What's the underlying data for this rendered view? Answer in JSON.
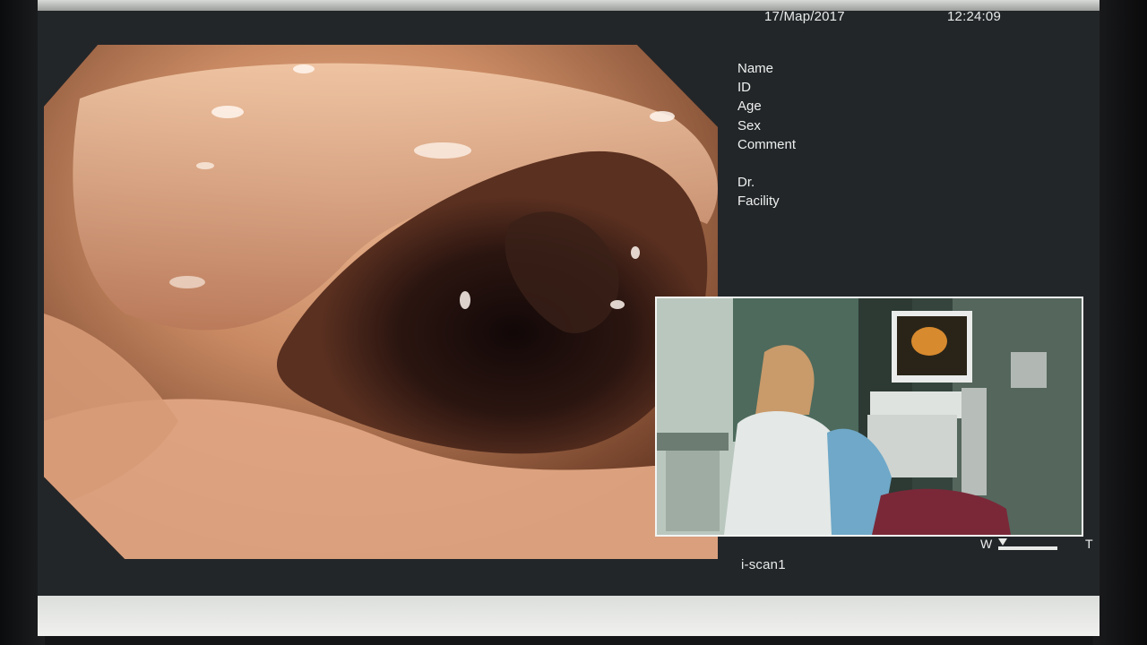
{
  "header": {
    "date": "17/Map/2017",
    "time": "12:24:09"
  },
  "patient_fields": {
    "name": "Name",
    "id": "ID",
    "age": "Age",
    "sex": "Sex",
    "comment": "Comment",
    "doctor": "Dr.",
    "facility": "Facility"
  },
  "zoom": {
    "wide_label": "W",
    "tele_label": "T"
  },
  "mode_label": "i-scan1",
  "colors": {
    "screen_bg": "#232629",
    "overlay_text": "#e9ebea",
    "pip_border": "#f2f4f2"
  }
}
